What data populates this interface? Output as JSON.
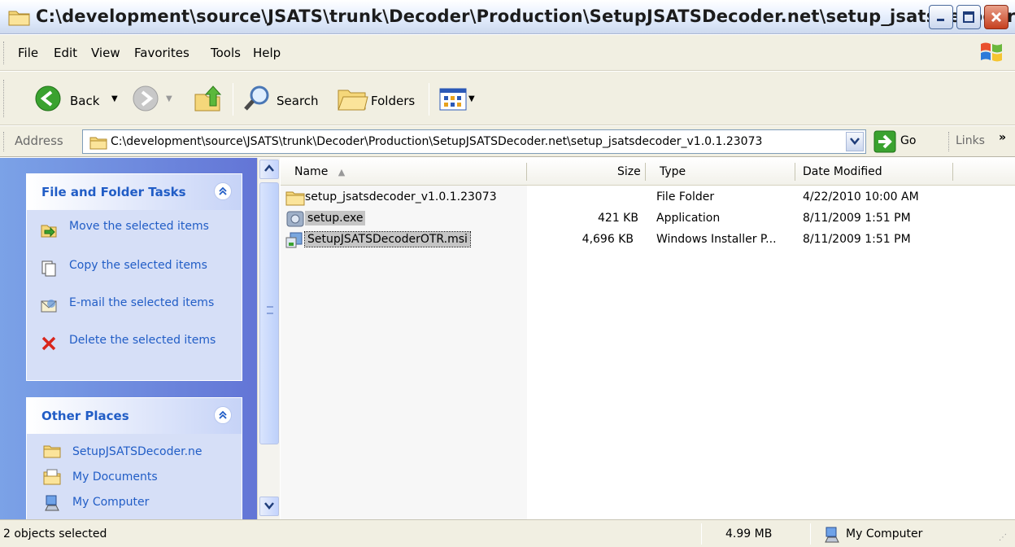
{
  "window": {
    "title": "C:\\development\\source\\JSATS\\trunk\\Decoder\\Production\\SetupJSATSDecoder.net\\setup_jsatsdecoder_v"
  },
  "menu": {
    "items": [
      "File",
      "Edit",
      "View",
      "Favorites",
      "Tools",
      "Help"
    ]
  },
  "toolbar": {
    "back_label": "Back",
    "search_label": "Search",
    "folders_label": "Folders"
  },
  "address": {
    "label": "Address",
    "value": "C:\\development\\source\\JSATS\\trunk\\Decoder\\Production\\SetupJSATSDecoder.net\\setup_jsatsdecoder_v1.0.1.23073",
    "go_label": "Go",
    "links_label": "Links"
  },
  "tasks_panel": {
    "title": "File and Folder Tasks",
    "items": [
      {
        "label": "Move the selected items",
        "icon": "move-icon"
      },
      {
        "label": "Copy the selected items",
        "icon": "copy-icon"
      },
      {
        "label": "E-mail the selected items",
        "icon": "email-icon"
      },
      {
        "label": "Delete the selected items",
        "icon": "delete-icon"
      }
    ]
  },
  "places_panel": {
    "title": "Other Places",
    "items": [
      {
        "label": "SetupJSATSDecoder.ne",
        "icon": "folder-icon"
      },
      {
        "label": "My Documents",
        "icon": "my-documents-icon"
      },
      {
        "label": "My Computer",
        "icon": "my-computer-icon"
      }
    ]
  },
  "file_list": {
    "columns": [
      "Name",
      "Size",
      "Type",
      "Date Modified"
    ],
    "rows": [
      {
        "name": "setup_jsatsdecoder_v1.0.1.23073",
        "size": "",
        "type": "File Folder",
        "date": "4/22/2010 10:00 AM",
        "selected": false,
        "icon": "folder-icon"
      },
      {
        "name": "setup.exe",
        "size": "421 KB",
        "type": "Application",
        "date": "8/11/2009 1:51 PM",
        "selected": true,
        "icon": "exe-icon"
      },
      {
        "name": "SetupJSATSDecoderOTR.msi",
        "size": "4,696 KB",
        "type": "Windows Installer P...",
        "date": "8/11/2009 1:51 PM",
        "selected": true,
        "icon": "msi-icon"
      }
    ]
  },
  "status": {
    "selection": "2 objects selected",
    "size": "4.99 MB",
    "zone": "My Computer"
  },
  "colors": {
    "link_blue": "#215dc6",
    "pane_gradient_start": "#7ba2e7",
    "pane_gradient_end": "#6375d6",
    "chrome": "#f1efe2"
  }
}
